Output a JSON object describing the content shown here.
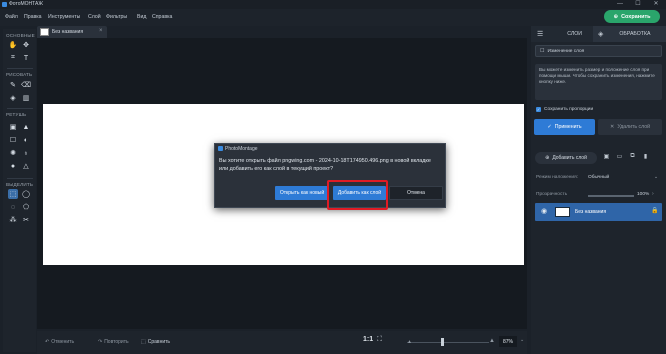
{
  "window": {
    "title": "ФотоМОНТАЖ",
    "min": "—",
    "max": "☐",
    "close": "✕"
  },
  "menu": [
    "Файл",
    "Правка",
    "Инструменты",
    "Слой",
    "Фильтры",
    "Вид",
    "Справка"
  ],
  "save_button": "Сохранить",
  "doc_tab": {
    "label": "Без названия",
    "close": "×"
  },
  "toolbar": {
    "sections": [
      "ОСНОВНЫЕ",
      "РИСОВАТЬ",
      "РЕТУШЬ",
      "ВЫДЕЛИТЬ"
    ]
  },
  "right_panel": {
    "tabs": [
      "СЛОИ",
      "ОБРАБОТКА"
    ],
    "resize_button": "Изменение слоя",
    "info_text": "Вы можете изменить размер и положение слоя при помощи мыши. Чтобы сохранить изменения, нажмите кнопку ниже.",
    "keep_proportions": "Сохранить пропорции",
    "apply_button": "Применить",
    "delete_layer_button": "Удалить слой",
    "add_layer_button": "Добавить слой",
    "blend_mode_label": "Режим наложения:",
    "blend_mode_value": "Обычный",
    "opacity_label": "Прозрачность",
    "opacity_value": "100%",
    "opacity_level": 1.0,
    "layer_name": "Без названия"
  },
  "bottom_bar": {
    "undo": "Отменить",
    "redo": "Повторить",
    "compare": "Сравнить",
    "ratio": "1:1",
    "zoom": "87%"
  },
  "dialog": {
    "title": "PhotoMontage",
    "message": "Вы хотите открыть файл pngwing.com - 2024-10-18T174950.496.png в новой вкладке или добавить его как слой в текущий проект?",
    "open_new": "Открыть как новый",
    "add_layer": "Добавить как слой",
    "cancel": "Отмена"
  },
  "colors": {
    "accent": "#2e7bd6",
    "save_green": "#2aa56b",
    "highlight_red": "#e01b24"
  }
}
